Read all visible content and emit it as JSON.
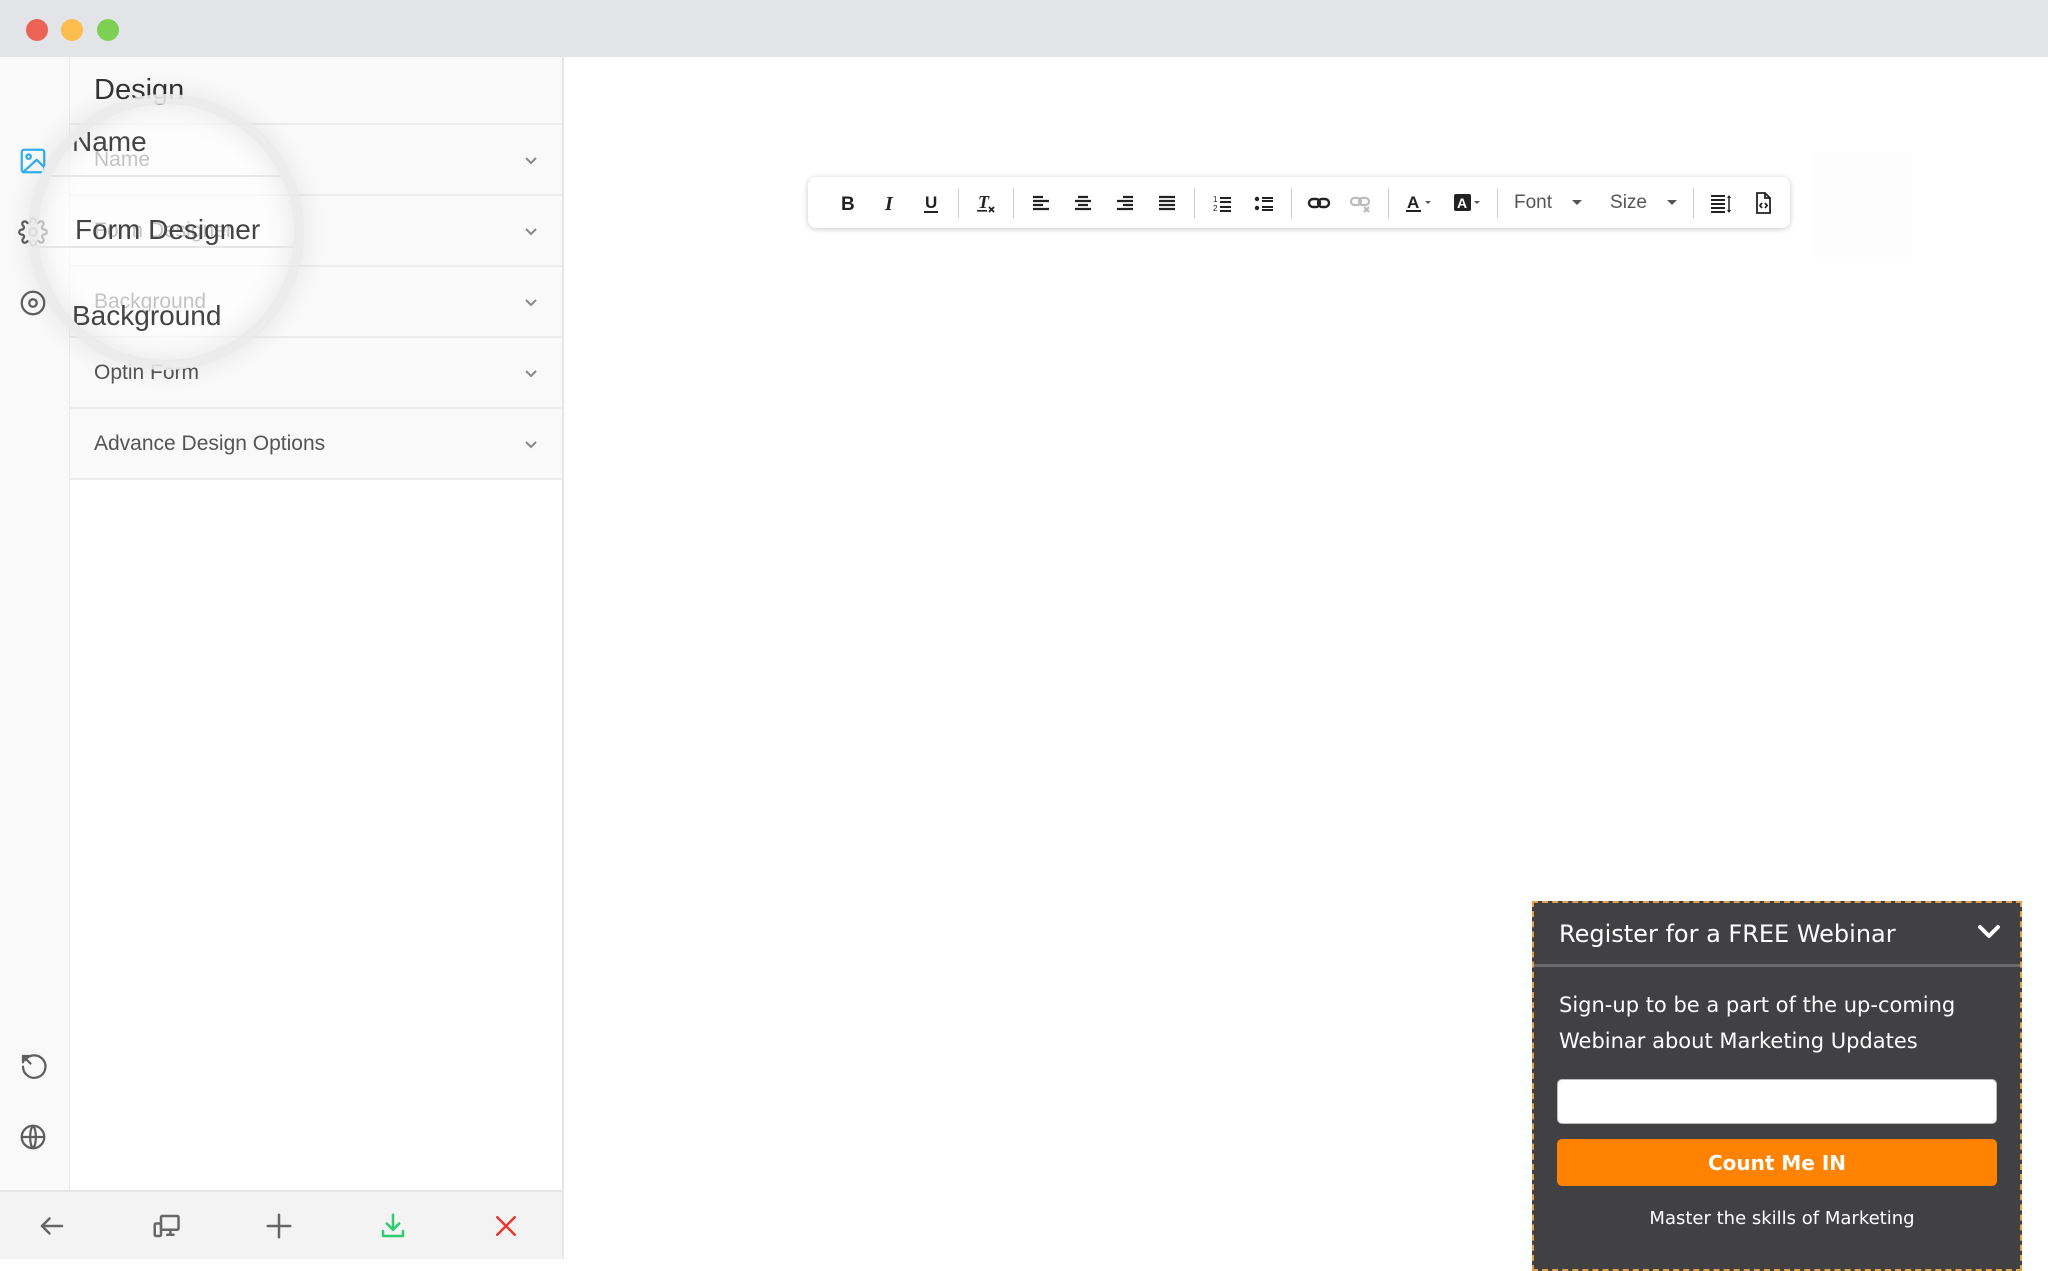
{
  "window": {
    "controls": [
      "close",
      "minimize",
      "maximize"
    ]
  },
  "rail": {
    "top_icons": [
      {
        "name": "image-icon",
        "active": true
      },
      {
        "name": "gear-icon",
        "active": false
      },
      {
        "name": "target-icon",
        "active": false
      }
    ],
    "bottom_icons": [
      {
        "name": "history-icon"
      },
      {
        "name": "globe-icon"
      }
    ],
    "active_color": "#34aef1"
  },
  "panel": {
    "title": "Design",
    "sections": [
      {
        "label": "Name"
      },
      {
        "label": "Form Designer"
      },
      {
        "label": "Background"
      },
      {
        "label": "Optin Form"
      },
      {
        "label": "Advance Design Options"
      }
    ],
    "magnifier": {
      "texts": [
        "Name",
        "Form Designer",
        "Background"
      ]
    }
  },
  "bottombar": {
    "buttons": [
      {
        "name": "back-arrow-icon",
        "color": "#666666"
      },
      {
        "name": "responsive-devices-icon",
        "color": "#666666"
      },
      {
        "name": "plus-icon",
        "color": "#666666"
      },
      {
        "name": "download-icon",
        "color": "#2ecc71"
      },
      {
        "name": "close-icon",
        "color": "#e8382f"
      }
    ]
  },
  "toolbar": {
    "buttons": [
      "bold",
      "italic",
      "underline",
      "clear-format",
      "align-left",
      "align-center",
      "align-right",
      "align-justify",
      "ordered-list",
      "unordered-list",
      "link",
      "unlink",
      "text-color",
      "background-color",
      "line-height",
      "source-code"
    ],
    "font_label": "Font",
    "size_label": "Size"
  },
  "widget": {
    "title": "Register for a FREE Webinar",
    "description": "Sign-up to be a part of the up-coming Webinar about Marketing Updates",
    "input_value": "",
    "button_label": "Count Me IN",
    "footer": "Master the skills of Marketing",
    "bg_color": "#414043",
    "button_color": "#ff8200"
  }
}
